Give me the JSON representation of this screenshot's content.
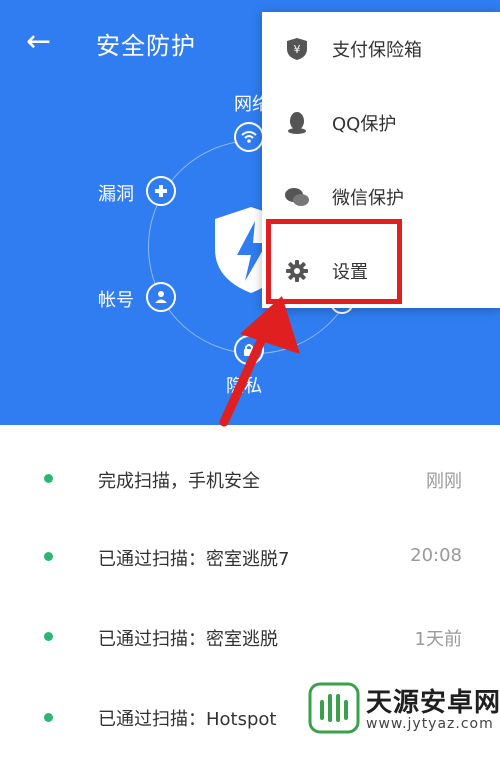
{
  "header": {
    "back_glyph": "←",
    "title": "安全防护",
    "nodes": {
      "network": "网络",
      "vulnerability": "漏洞",
      "account": "帐号",
      "privacy": "隐私"
    },
    "background_color": "#2f7df0"
  },
  "menu": {
    "items": [
      {
        "label": "支付保险箱",
        "icon": "payment-safe-icon"
      },
      {
        "label": "QQ保护",
        "icon": "qq-icon"
      },
      {
        "label": "微信保护",
        "icon": "wechat-icon"
      },
      {
        "label": "设置",
        "icon": "gear-icon"
      }
    ]
  },
  "annotation": {
    "highlight_color": "#e02020"
  },
  "list": {
    "rows": [
      {
        "text": "完成扫描，手机安全",
        "time": "刚刚"
      },
      {
        "text": "已通过扫描：密室逃脱7",
        "time": "20:08"
      },
      {
        "text": "已通过扫描：密室逃脱",
        "time": "1天前"
      },
      {
        "text": "已通过扫描：Hotspot",
        "time": ""
      }
    ],
    "dot_color": "#2bb673"
  },
  "watermark": {
    "name": "天源安卓网",
    "url": "www.jytyaz.com"
  }
}
